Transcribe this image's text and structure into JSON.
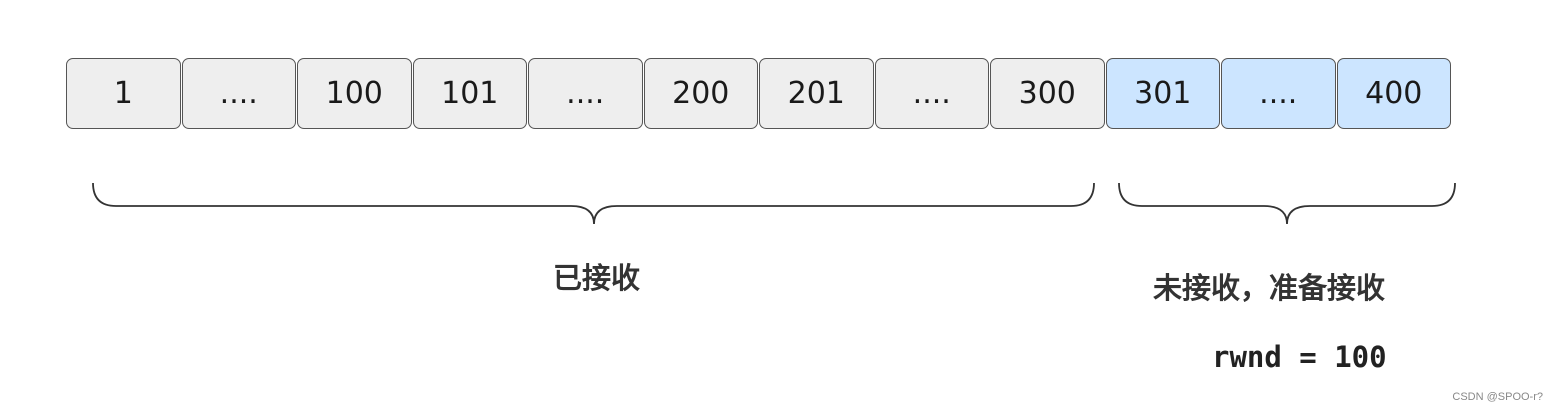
{
  "sequence": {
    "cells": [
      {
        "label": "1",
        "state": "received"
      },
      {
        "label": "....",
        "state": "received"
      },
      {
        "label": "100",
        "state": "received"
      },
      {
        "label": "101",
        "state": "received"
      },
      {
        "label": "....",
        "state": "received"
      },
      {
        "label": "200",
        "state": "received"
      },
      {
        "label": "201",
        "state": "received"
      },
      {
        "label": "....",
        "state": "received"
      },
      {
        "label": "300",
        "state": "received"
      },
      {
        "label": "301",
        "state": "pending"
      },
      {
        "label": "....",
        "state": "pending"
      },
      {
        "label": "400",
        "state": "pending"
      }
    ]
  },
  "groups": {
    "received": {
      "label": "已接收"
    },
    "pending": {
      "label": "未接收，准备接收"
    }
  },
  "rwnd": {
    "text": "rwnd = 100"
  },
  "watermark": "CSDN @SPOO-r?",
  "colors": {
    "received_fill": "#eeeeee",
    "pending_fill": "#cce5ff",
    "border": "#555555",
    "brace": "#333333"
  }
}
